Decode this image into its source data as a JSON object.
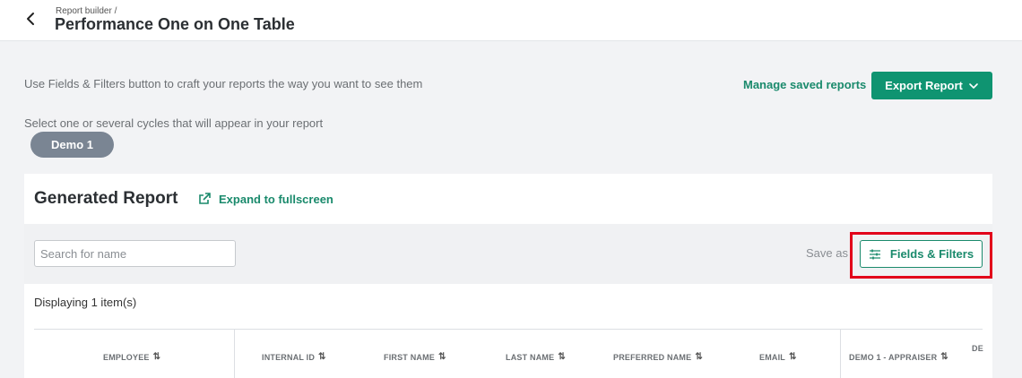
{
  "header": {
    "breadcrumb": "Report builder /",
    "title": "Performance One on One Table"
  },
  "intro_text": "Use Fields & Filters button to craft your reports the way you want to see them",
  "manage_saved_reports": "Manage saved reports",
  "export_button": "Export Report",
  "cycles": {
    "label": "Select one or several cycles that will appear in your report",
    "selected": [
      "Demo 1"
    ]
  },
  "report": {
    "title": "Generated Report",
    "expand_label": "Expand to fullscreen",
    "search_placeholder": "Search for name",
    "save_as": "Save as",
    "fields_filters": "Fields & Filters",
    "displaying": "Displaying 1 item(s)",
    "columns": [
      "EMPLOYEE",
      "INTERNAL ID",
      "FIRST NAME",
      "LAST NAME",
      "PREFERRED NAME",
      "EMAIL",
      "DEMO 1 - APPRAISER",
      "DE"
    ]
  },
  "colors": {
    "accent": "#0f9471",
    "link": "#1a8a6c",
    "highlight": "#e2001a",
    "pill": "#7a8593"
  }
}
